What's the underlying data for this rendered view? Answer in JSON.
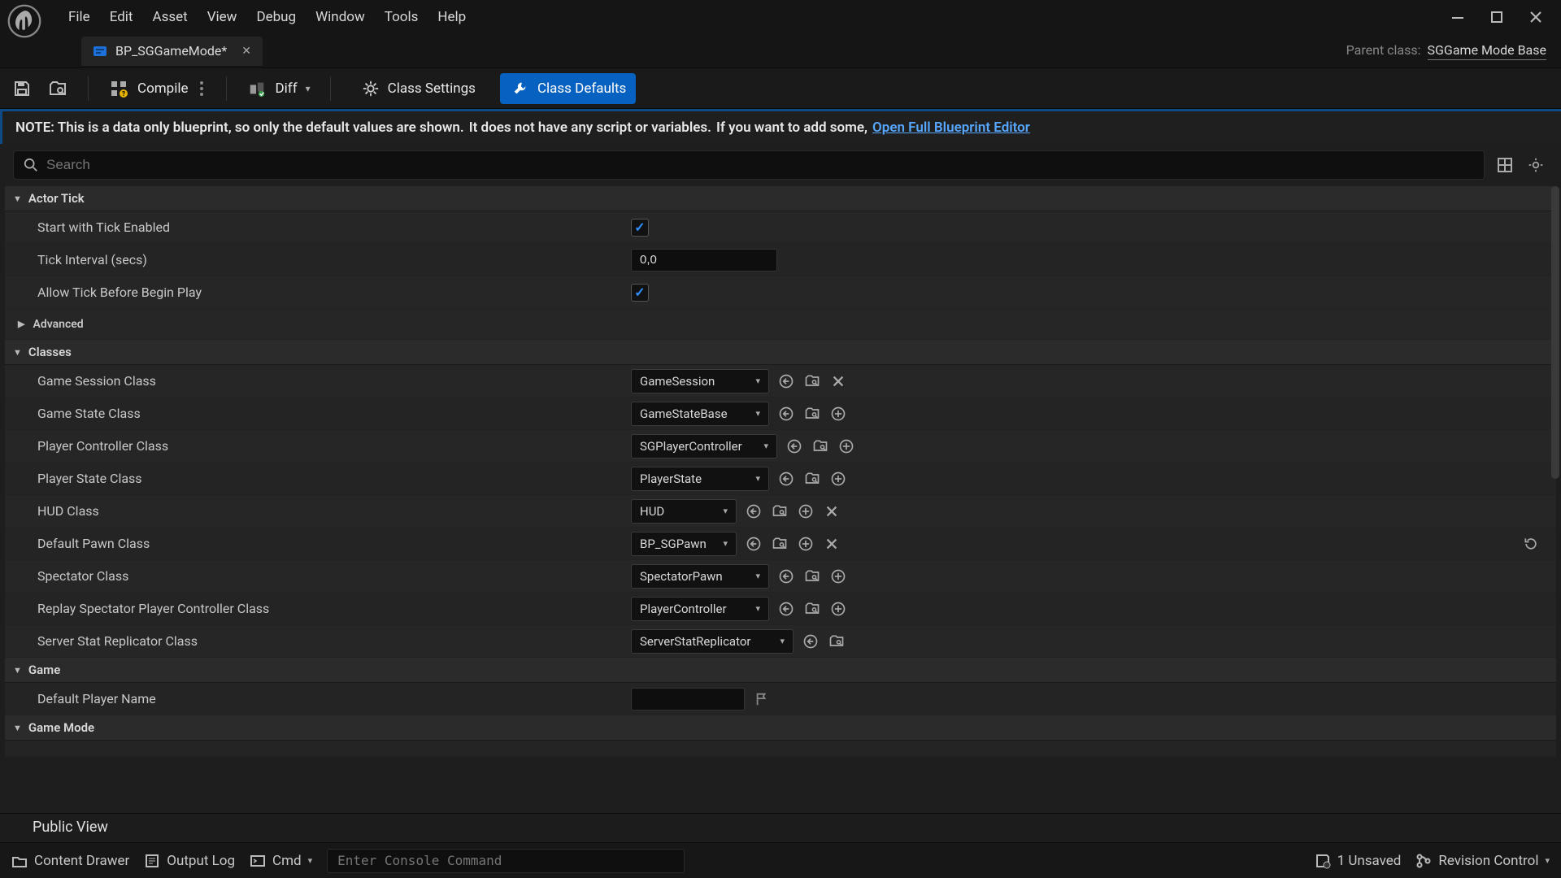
{
  "menu": {
    "items": [
      "File",
      "Edit",
      "Asset",
      "View",
      "Debug",
      "Window",
      "Tools",
      "Help"
    ]
  },
  "tab": {
    "title": "BP_SGGameMode*"
  },
  "parent_class": {
    "label": "Parent class:",
    "value": "SGGame Mode Base"
  },
  "toolbar": {
    "compile": "Compile",
    "diff": "Diff",
    "class_settings": "Class Settings",
    "class_defaults": "Class Defaults"
  },
  "note": {
    "text_a": "NOTE: This is a data only blueprint, so only the default values are shown.",
    "text_b": "It does not have any script or variables.",
    "text_c": "If you want to add some,",
    "link": "Open Full Blueprint Editor"
  },
  "search": {
    "placeholder": "Search"
  },
  "categories": {
    "actor_tick": "Actor Tick",
    "advanced": "Advanced",
    "classes": "Classes",
    "game": "Game",
    "game_mode": "Game Mode"
  },
  "actor_tick": {
    "start_with_tick_enabled": {
      "label": "Start with Tick Enabled",
      "checked": true
    },
    "tick_interval": {
      "label": "Tick Interval (secs)",
      "value": "0,0"
    },
    "allow_before_begin": {
      "label": "Allow Tick Before Begin Play",
      "checked": true
    }
  },
  "classes": {
    "game_session": {
      "label": "Game Session Class",
      "value": "GameSession",
      "dd_w": 170,
      "actions": [
        "use",
        "browse",
        "clear"
      ]
    },
    "game_state": {
      "label": "Game State Class",
      "value": "GameStateBase",
      "dd_w": 170,
      "actions": [
        "use",
        "browse",
        "add"
      ]
    },
    "player_controller": {
      "label": "Player Controller Class",
      "value": "SGPlayerController",
      "dd_w": 180,
      "actions": [
        "use",
        "browse",
        "add"
      ]
    },
    "player_state": {
      "label": "Player State Class",
      "value": "PlayerState",
      "dd_w": 170,
      "actions": [
        "use",
        "browse",
        "add"
      ]
    },
    "hud": {
      "label": "HUD Class",
      "value": "HUD",
      "dd_w": 130,
      "actions": [
        "use",
        "browse",
        "add",
        "clear"
      ]
    },
    "default_pawn": {
      "label": "Default Pawn Class",
      "value": "BP_SGPawn",
      "dd_w": 130,
      "actions": [
        "use",
        "browse",
        "add",
        "clear"
      ],
      "revert": true
    },
    "spectator": {
      "label": "Spectator Class",
      "value": "SpectatorPawn",
      "dd_w": 170,
      "actions": [
        "use",
        "browse",
        "add"
      ]
    },
    "replay_spectator": {
      "label": "Replay Spectator Player Controller Class",
      "value": "PlayerController",
      "dd_w": 170,
      "actions": [
        "use",
        "browse",
        "add"
      ]
    },
    "server_stat": {
      "label": "Server Stat Replicator Class",
      "value": "ServerStatReplicator",
      "dd_w": 200,
      "actions": [
        "use",
        "browse"
      ]
    }
  },
  "game": {
    "default_player_name": {
      "label": "Default Player Name",
      "value": ""
    }
  },
  "public_view": "Public View",
  "statusbar": {
    "content_drawer": "Content Drawer",
    "output_log": "Output Log",
    "cmd": "Cmd",
    "console_placeholder": "Enter Console Command",
    "unsaved": "1 Unsaved",
    "revision": "Revision Control"
  }
}
